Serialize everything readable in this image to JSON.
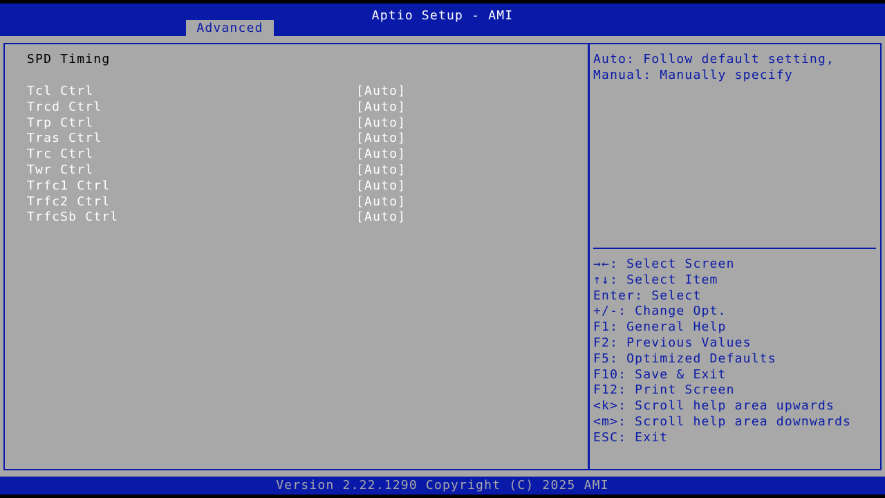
{
  "header": {
    "title": "Aptio Setup - AMI",
    "tabs": [
      {
        "label": "Advanced",
        "active": true
      }
    ]
  },
  "main": {
    "section_title": "SPD Timing",
    "settings": [
      {
        "label": "Tcl Ctrl",
        "value": "[Auto]"
      },
      {
        "label": "Trcd Ctrl",
        "value": "[Auto]"
      },
      {
        "label": "Trp Ctrl",
        "value": "[Auto]"
      },
      {
        "label": "Tras Ctrl",
        "value": "[Auto]"
      },
      {
        "label": "Trc Ctrl",
        "value": "[Auto]"
      },
      {
        "label": "Twr Ctrl",
        "value": "[Auto]"
      },
      {
        "label": "Trfc1 Ctrl",
        "value": "[Auto]"
      },
      {
        "label": "Trfc2 Ctrl",
        "value": "[Auto]"
      },
      {
        "label": "TrfcSb Ctrl",
        "value": "[Auto]"
      }
    ]
  },
  "help": {
    "lines": [
      "Auto: Follow default setting,",
      "Manual: Manually specify"
    ]
  },
  "keys": [
    "→←: Select Screen",
    "↑↓: Select Item",
    "Enter: Select",
    "+/-: Change Opt.",
    "F1: General Help",
    "F2: Previous Values",
    "F5: Optimized Defaults",
    "F10: Save & Exit",
    "F12: Print Screen",
    "<k>: Scroll help area upwards",
    "<m>: Scroll help area downwards",
    "ESC: Exit"
  ],
  "footer": {
    "version": "Version 2.22.1290 Copyright (C) 2025 AMI"
  },
  "colors": {
    "header_blue": "#0a1aa8",
    "panel_gray": "#a8a8a8",
    "highlight_white": "#ffffff"
  }
}
